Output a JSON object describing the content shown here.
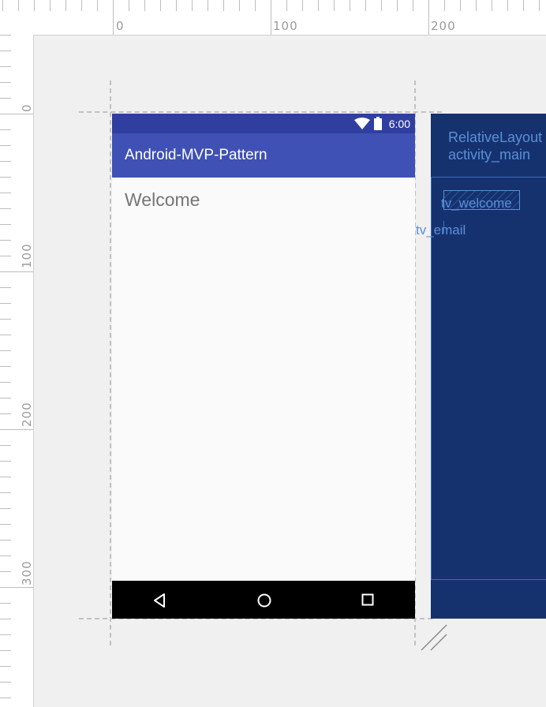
{
  "ruler": {
    "horizontal_labels": [
      "0",
      "100",
      "200"
    ],
    "vertical_labels": [
      "0",
      "100",
      "200",
      "300"
    ]
  },
  "device": {
    "status_bar": {
      "time": "6:00",
      "icons": [
        "wifi-icon",
        "battery-icon"
      ]
    },
    "app_bar": {
      "title": "Android-MVP-Pattern"
    },
    "content": {
      "welcome_text": "Welcome"
    },
    "nav_bar": {
      "icons": [
        "back-icon",
        "home-icon",
        "recents-icon"
      ]
    }
  },
  "blueprint": {
    "root_layout_label": "RelativeLayout",
    "root_layout_id": "activity_main",
    "welcome_id": "tv_welcome",
    "email_id": "tv_email"
  },
  "colors": {
    "primary": "#3f51b5",
    "primary_dark": "#303f9f",
    "blueprint_bg": "#15326f",
    "blueprint_text": "#5a8fd6",
    "canvas_bg": "#f0f0f0"
  }
}
